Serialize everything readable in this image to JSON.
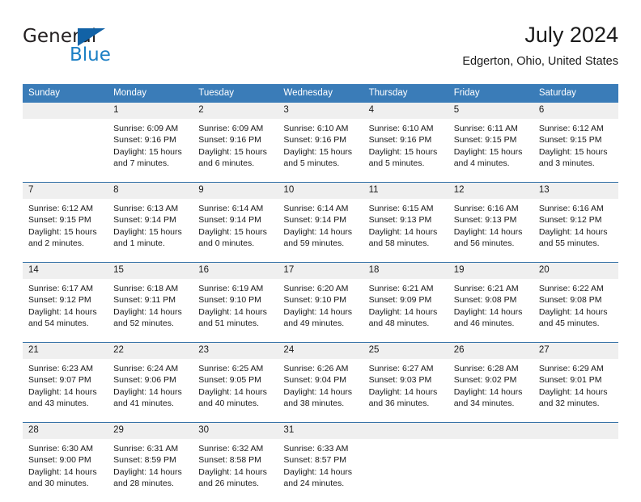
{
  "brand": {
    "name_top": "General",
    "name_bottom": "Blue",
    "colors": {
      "general_text": "#231f20",
      "blue_text": "#1b7fc4",
      "triangle": "#1262a6"
    }
  },
  "header": {
    "title": "July 2024",
    "subtitle": "Edgerton, Ohio, United States"
  },
  "calendar": {
    "colors": {
      "header_bg": "#3a7cb8",
      "header_text": "#ffffff",
      "daynum_bg": "#efefef",
      "week_divider": "#2e6da4",
      "cell_text": "#1a1a1a"
    },
    "weekday_headers": [
      "Sunday",
      "Monday",
      "Tuesday",
      "Wednesday",
      "Thursday",
      "Friday",
      "Saturday"
    ],
    "weeks": [
      [
        {
          "day": "",
          "sunrise": "",
          "sunset": "",
          "daylight_line1": "",
          "daylight_line2": ""
        },
        {
          "day": "1",
          "sunrise": "Sunrise: 6:09 AM",
          "sunset": "Sunset: 9:16 PM",
          "daylight_line1": "Daylight: 15 hours",
          "daylight_line2": "and 7 minutes."
        },
        {
          "day": "2",
          "sunrise": "Sunrise: 6:09 AM",
          "sunset": "Sunset: 9:16 PM",
          "daylight_line1": "Daylight: 15 hours",
          "daylight_line2": "and 6 minutes."
        },
        {
          "day": "3",
          "sunrise": "Sunrise: 6:10 AM",
          "sunset": "Sunset: 9:16 PM",
          "daylight_line1": "Daylight: 15 hours",
          "daylight_line2": "and 5 minutes."
        },
        {
          "day": "4",
          "sunrise": "Sunrise: 6:10 AM",
          "sunset": "Sunset: 9:16 PM",
          "daylight_line1": "Daylight: 15 hours",
          "daylight_line2": "and 5 minutes."
        },
        {
          "day": "5",
          "sunrise": "Sunrise: 6:11 AM",
          "sunset": "Sunset: 9:15 PM",
          "daylight_line1": "Daylight: 15 hours",
          "daylight_line2": "and 4 minutes."
        },
        {
          "day": "6",
          "sunrise": "Sunrise: 6:12 AM",
          "sunset": "Sunset: 9:15 PM",
          "daylight_line1": "Daylight: 15 hours",
          "daylight_line2": "and 3 minutes."
        }
      ],
      [
        {
          "day": "7",
          "sunrise": "Sunrise: 6:12 AM",
          "sunset": "Sunset: 9:15 PM",
          "daylight_line1": "Daylight: 15 hours",
          "daylight_line2": "and 2 minutes."
        },
        {
          "day": "8",
          "sunrise": "Sunrise: 6:13 AM",
          "sunset": "Sunset: 9:14 PM",
          "daylight_line1": "Daylight: 15 hours",
          "daylight_line2": "and 1 minute."
        },
        {
          "day": "9",
          "sunrise": "Sunrise: 6:14 AM",
          "sunset": "Sunset: 9:14 PM",
          "daylight_line1": "Daylight: 15 hours",
          "daylight_line2": "and 0 minutes."
        },
        {
          "day": "10",
          "sunrise": "Sunrise: 6:14 AM",
          "sunset": "Sunset: 9:14 PM",
          "daylight_line1": "Daylight: 14 hours",
          "daylight_line2": "and 59 minutes."
        },
        {
          "day": "11",
          "sunrise": "Sunrise: 6:15 AM",
          "sunset": "Sunset: 9:13 PM",
          "daylight_line1": "Daylight: 14 hours",
          "daylight_line2": "and 58 minutes."
        },
        {
          "day": "12",
          "sunrise": "Sunrise: 6:16 AM",
          "sunset": "Sunset: 9:13 PM",
          "daylight_line1": "Daylight: 14 hours",
          "daylight_line2": "and 56 minutes."
        },
        {
          "day": "13",
          "sunrise": "Sunrise: 6:16 AM",
          "sunset": "Sunset: 9:12 PM",
          "daylight_line1": "Daylight: 14 hours",
          "daylight_line2": "and 55 minutes."
        }
      ],
      [
        {
          "day": "14",
          "sunrise": "Sunrise: 6:17 AM",
          "sunset": "Sunset: 9:12 PM",
          "daylight_line1": "Daylight: 14 hours",
          "daylight_line2": "and 54 minutes."
        },
        {
          "day": "15",
          "sunrise": "Sunrise: 6:18 AM",
          "sunset": "Sunset: 9:11 PM",
          "daylight_line1": "Daylight: 14 hours",
          "daylight_line2": "and 52 minutes."
        },
        {
          "day": "16",
          "sunrise": "Sunrise: 6:19 AM",
          "sunset": "Sunset: 9:10 PM",
          "daylight_line1": "Daylight: 14 hours",
          "daylight_line2": "and 51 minutes."
        },
        {
          "day": "17",
          "sunrise": "Sunrise: 6:20 AM",
          "sunset": "Sunset: 9:10 PM",
          "daylight_line1": "Daylight: 14 hours",
          "daylight_line2": "and 49 minutes."
        },
        {
          "day": "18",
          "sunrise": "Sunrise: 6:21 AM",
          "sunset": "Sunset: 9:09 PM",
          "daylight_line1": "Daylight: 14 hours",
          "daylight_line2": "and 48 minutes."
        },
        {
          "day": "19",
          "sunrise": "Sunrise: 6:21 AM",
          "sunset": "Sunset: 9:08 PM",
          "daylight_line1": "Daylight: 14 hours",
          "daylight_line2": "and 46 minutes."
        },
        {
          "day": "20",
          "sunrise": "Sunrise: 6:22 AM",
          "sunset": "Sunset: 9:08 PM",
          "daylight_line1": "Daylight: 14 hours",
          "daylight_line2": "and 45 minutes."
        }
      ],
      [
        {
          "day": "21",
          "sunrise": "Sunrise: 6:23 AM",
          "sunset": "Sunset: 9:07 PM",
          "daylight_line1": "Daylight: 14 hours",
          "daylight_line2": "and 43 minutes."
        },
        {
          "day": "22",
          "sunrise": "Sunrise: 6:24 AM",
          "sunset": "Sunset: 9:06 PM",
          "daylight_line1": "Daylight: 14 hours",
          "daylight_line2": "and 41 minutes."
        },
        {
          "day": "23",
          "sunrise": "Sunrise: 6:25 AM",
          "sunset": "Sunset: 9:05 PM",
          "daylight_line1": "Daylight: 14 hours",
          "daylight_line2": "and 40 minutes."
        },
        {
          "day": "24",
          "sunrise": "Sunrise: 6:26 AM",
          "sunset": "Sunset: 9:04 PM",
          "daylight_line1": "Daylight: 14 hours",
          "daylight_line2": "and 38 minutes."
        },
        {
          "day": "25",
          "sunrise": "Sunrise: 6:27 AM",
          "sunset": "Sunset: 9:03 PM",
          "daylight_line1": "Daylight: 14 hours",
          "daylight_line2": "and 36 minutes."
        },
        {
          "day": "26",
          "sunrise": "Sunrise: 6:28 AM",
          "sunset": "Sunset: 9:02 PM",
          "daylight_line1": "Daylight: 14 hours",
          "daylight_line2": "and 34 minutes."
        },
        {
          "day": "27",
          "sunrise": "Sunrise: 6:29 AM",
          "sunset": "Sunset: 9:01 PM",
          "daylight_line1": "Daylight: 14 hours",
          "daylight_line2": "and 32 minutes."
        }
      ],
      [
        {
          "day": "28",
          "sunrise": "Sunrise: 6:30 AM",
          "sunset": "Sunset: 9:00 PM",
          "daylight_line1": "Daylight: 14 hours",
          "daylight_line2": "and 30 minutes."
        },
        {
          "day": "29",
          "sunrise": "Sunrise: 6:31 AM",
          "sunset": "Sunset: 8:59 PM",
          "daylight_line1": "Daylight: 14 hours",
          "daylight_line2": "and 28 minutes."
        },
        {
          "day": "30",
          "sunrise": "Sunrise: 6:32 AM",
          "sunset": "Sunset: 8:58 PM",
          "daylight_line1": "Daylight: 14 hours",
          "daylight_line2": "and 26 minutes."
        },
        {
          "day": "31",
          "sunrise": "Sunrise: 6:33 AM",
          "sunset": "Sunset: 8:57 PM",
          "daylight_line1": "Daylight: 14 hours",
          "daylight_line2": "and 24 minutes."
        },
        {
          "day": "",
          "sunrise": "",
          "sunset": "",
          "daylight_line1": "",
          "daylight_line2": ""
        },
        {
          "day": "",
          "sunrise": "",
          "sunset": "",
          "daylight_line1": "",
          "daylight_line2": ""
        },
        {
          "day": "",
          "sunrise": "",
          "sunset": "",
          "daylight_line1": "",
          "daylight_line2": ""
        }
      ]
    ]
  }
}
